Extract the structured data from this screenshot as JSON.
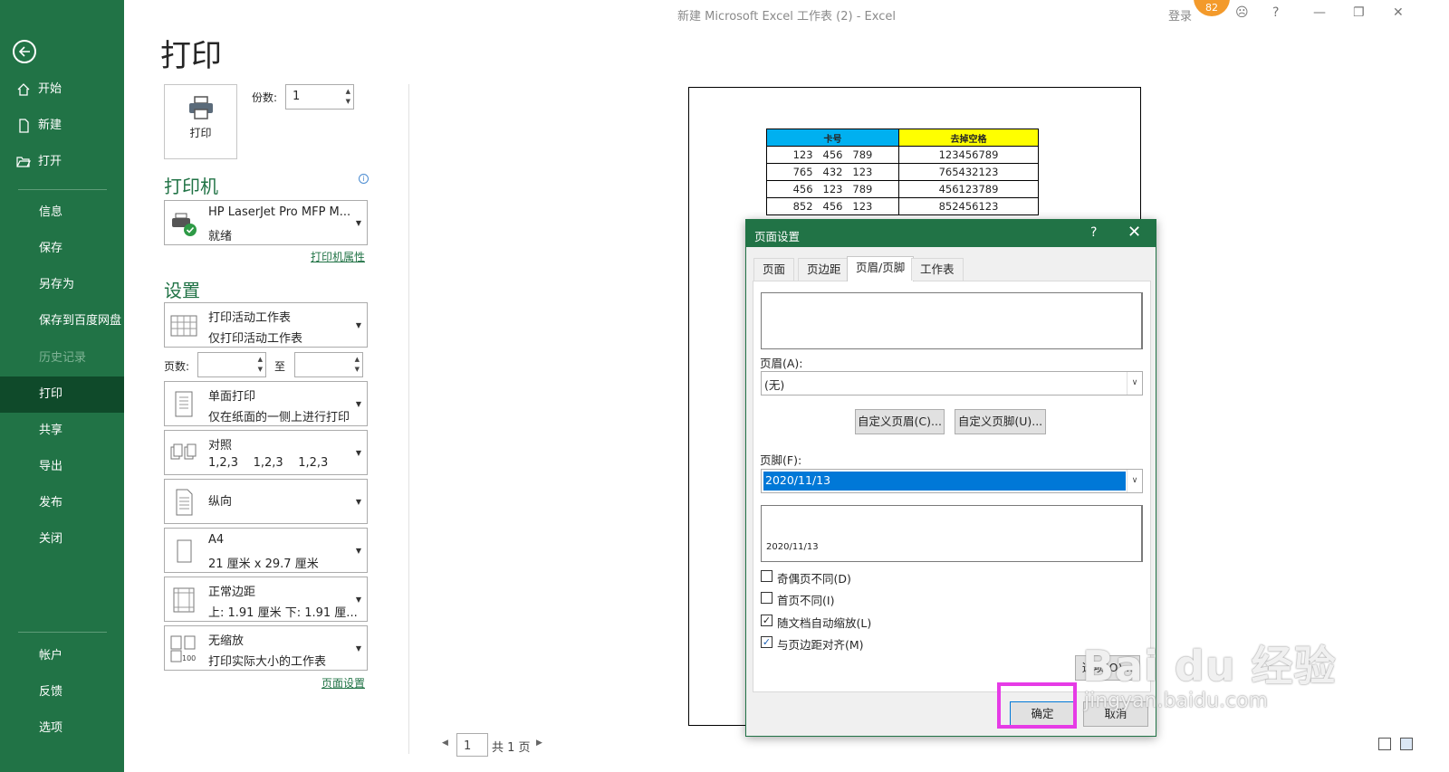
{
  "window": {
    "title": "新建 Microsoft Excel 工作表 (2)  -  Excel",
    "login": "登录",
    "avatar_badge": "82"
  },
  "nav": {
    "items": [
      {
        "label": "开始",
        "icon": "home-icon"
      },
      {
        "label": "新建",
        "icon": "new-doc-icon"
      },
      {
        "label": "打开",
        "icon": "open-folder-icon"
      },
      {
        "label": "信息"
      },
      {
        "label": "保存"
      },
      {
        "label": "另存为"
      },
      {
        "label": "保存到百度网盘"
      },
      {
        "label": "历史记录"
      },
      {
        "label": "打印"
      },
      {
        "label": "共享"
      },
      {
        "label": "导出"
      },
      {
        "label": "发布"
      },
      {
        "label": "关闭"
      },
      {
        "label": "帐户"
      },
      {
        "label": "反馈"
      },
      {
        "label": "选项"
      }
    ]
  },
  "print": {
    "page_title": "打印",
    "print_button": "打印",
    "copies_label": "份数:",
    "copies_value": "1",
    "printer_section": "打印机",
    "printer_name": "HP LaserJet Pro MFP M...",
    "printer_status": "就绪",
    "printer_properties": "打印机属性",
    "settings_section": "设置",
    "scope_main": "打印活动工作表",
    "scope_sub": "仅打印活动工作表",
    "pages_label": "页数:",
    "to_label": "至",
    "sides_main": "单面打印",
    "sides_sub": "仅在纸面的一侧上进行打印",
    "collate_main": "对照",
    "collate_sub": "1,2,3    1,2,3    1,2,3",
    "orientation": "纵向",
    "paper_main": "A4",
    "paper_sub": "21 厘米 x 29.7 厘米",
    "margins_main": "正常边距",
    "margins_sub": "上: 1.91 厘米 下: 1.91 厘...",
    "scaling_main": "无缩放",
    "scaling_sub": "打印实际大小的工作表",
    "page_setup_link": "页面设置"
  },
  "preview": {
    "headers": [
      "卡号",
      "去掉空格"
    ],
    "header_colors": [
      "#00b0f0",
      "#ffff00"
    ],
    "rows": [
      [
        "123   456   789",
        "123456789"
      ],
      [
        "765   432   123",
        "765432123"
      ],
      [
        "456   123   789",
        "456123789"
      ],
      [
        "852   456   123",
        "852456123"
      ]
    ],
    "pager_value": "1",
    "pager_total": "共 1 页"
  },
  "dialog": {
    "title": "页面设置",
    "help": "?",
    "tabs": [
      "页面",
      "页边距",
      "页眉/页脚",
      "工作表"
    ],
    "header_label": "页眉(A):",
    "header_value": "(无)",
    "custom_header": "自定义页眉(C)...",
    "custom_footer": "自定义页脚(U)...",
    "footer_label": "页脚(F):",
    "footer_value": "2020/11/13",
    "footer_preview_text": "2020/11/13",
    "checkboxes": [
      {
        "label": "奇偶页不同(D)",
        "checked": false
      },
      {
        "label": "首页不同(I)",
        "checked": false
      },
      {
        "label": "随文档自动缩放(L)",
        "checked": true
      },
      {
        "label": "与页边距对齐(M)",
        "checked": true
      }
    ],
    "options_button": "选项(O)...",
    "ok_button": "确定",
    "cancel_button": "取消"
  },
  "watermark": {
    "big": "Bai du 经验",
    "small": "jingyan.baidu.com"
  }
}
